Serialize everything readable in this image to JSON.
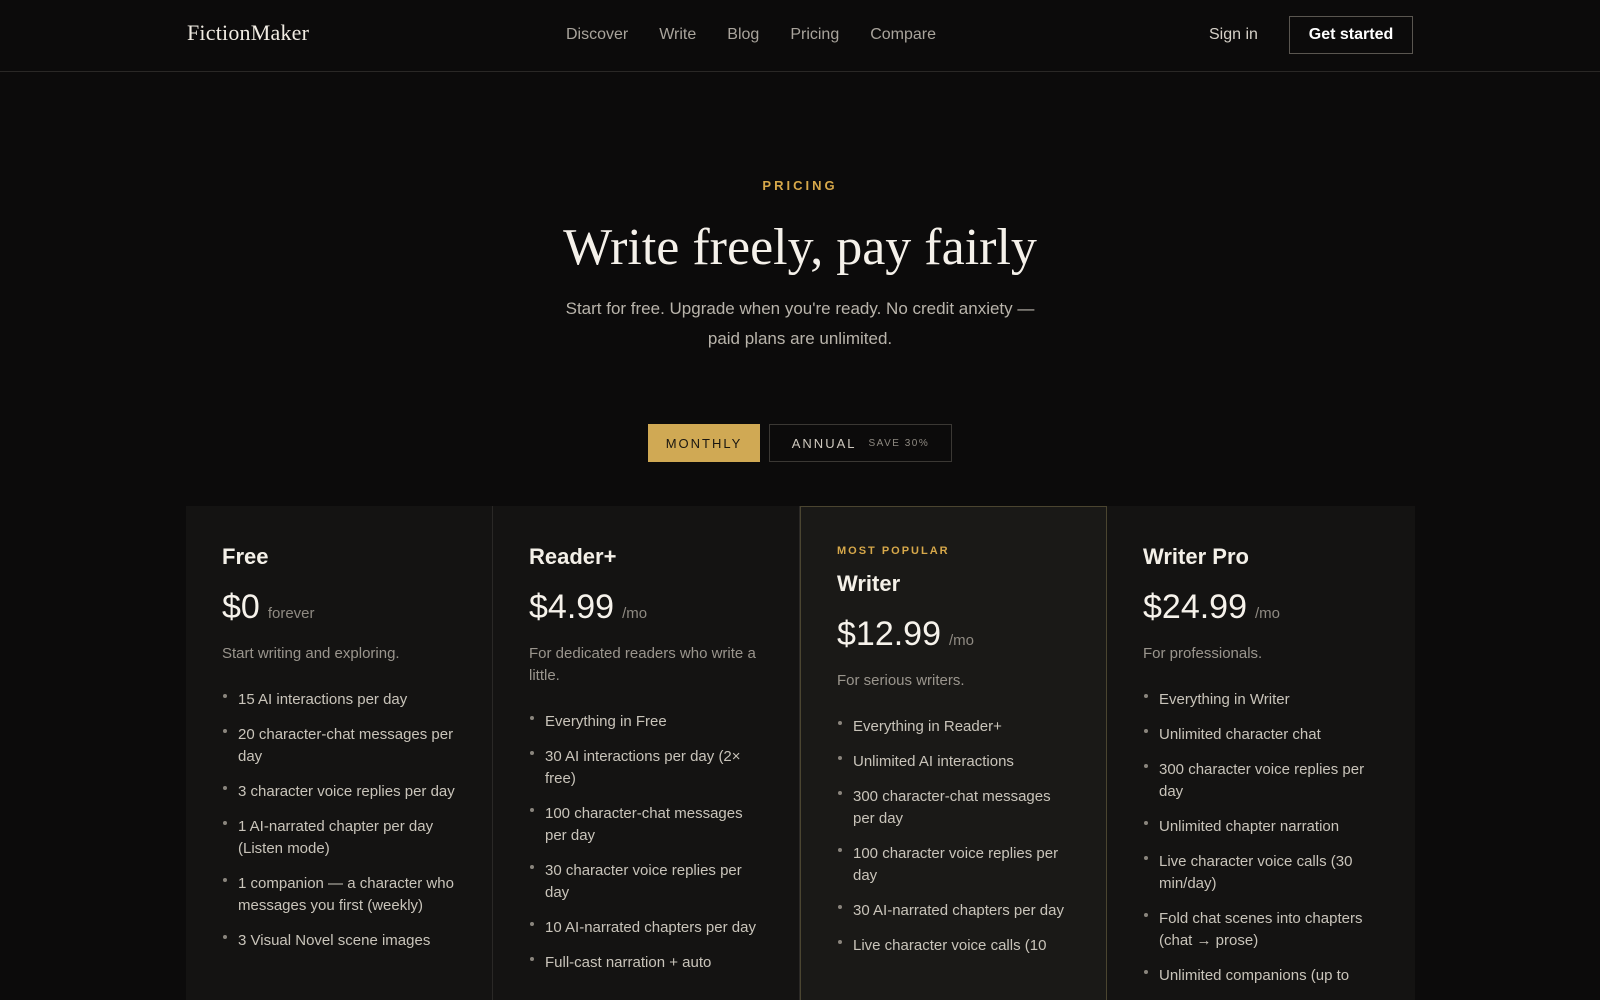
{
  "header": {
    "logo": "FictionMaker",
    "nav": [
      "Discover",
      "Write",
      "Blog",
      "Pricing",
      "Compare"
    ],
    "signin": "Sign in",
    "cta": "Get started"
  },
  "hero": {
    "eyebrow": "PRICING",
    "title": "Write freely, pay fairly",
    "subtitle": "Start for free. Upgrade when you're ready. No credit anxiety — paid plans are unlimited."
  },
  "toggle": {
    "monthly": "MONTHLY",
    "annual": "ANNUAL",
    "save": "SAVE 30%",
    "selected": "MONTHLY"
  },
  "plans": [
    {
      "name": "Free",
      "price": "$0",
      "period": "forever",
      "description": "Start writing and exploring.",
      "features": [
        "15 AI interactions per day",
        "20 character-chat messages per day",
        "3 character voice replies per day",
        "1 AI-narrated chapter per day (Listen mode)",
        "1 companion — a character who messages you first (weekly)",
        "3 Visual Novel scene images"
      ]
    },
    {
      "name": "Reader+",
      "price": "$4.99",
      "period": "/mo",
      "description": "For dedicated readers who write a little.",
      "features": [
        "Everything in Free",
        "30 AI interactions per day (2× free)",
        "100 character-chat messages per day",
        "30 character voice replies per day",
        "10 AI-narrated chapters per day",
        "Full-cast narration + auto"
      ]
    },
    {
      "tag": "MOST POPULAR",
      "name": "Writer",
      "price": "$12.99",
      "period": "/mo",
      "description": "For serious writers.",
      "features": [
        "Everything in Reader+",
        "Unlimited AI interactions",
        "300 character-chat messages per day",
        "100 character voice replies per day",
        "30 AI-narrated chapters per day",
        "Live character voice calls (10"
      ]
    },
    {
      "name": "Writer Pro",
      "price": "$24.99",
      "period": "/mo",
      "description": "For professionals.",
      "features": [
        "Everything in Writer",
        "Unlimited character chat",
        "300 character voice replies per day",
        "Unlimited chapter narration",
        "Live character voice calls (30 min/day)",
        "Fold chat scenes into chapters (chat → prose)",
        "Unlimited companions (up to"
      ]
    }
  ],
  "colors": {
    "background": "#0c0b0b",
    "accent": "#d0a954",
    "card": "#141312",
    "card_popular": "#1a1917"
  }
}
